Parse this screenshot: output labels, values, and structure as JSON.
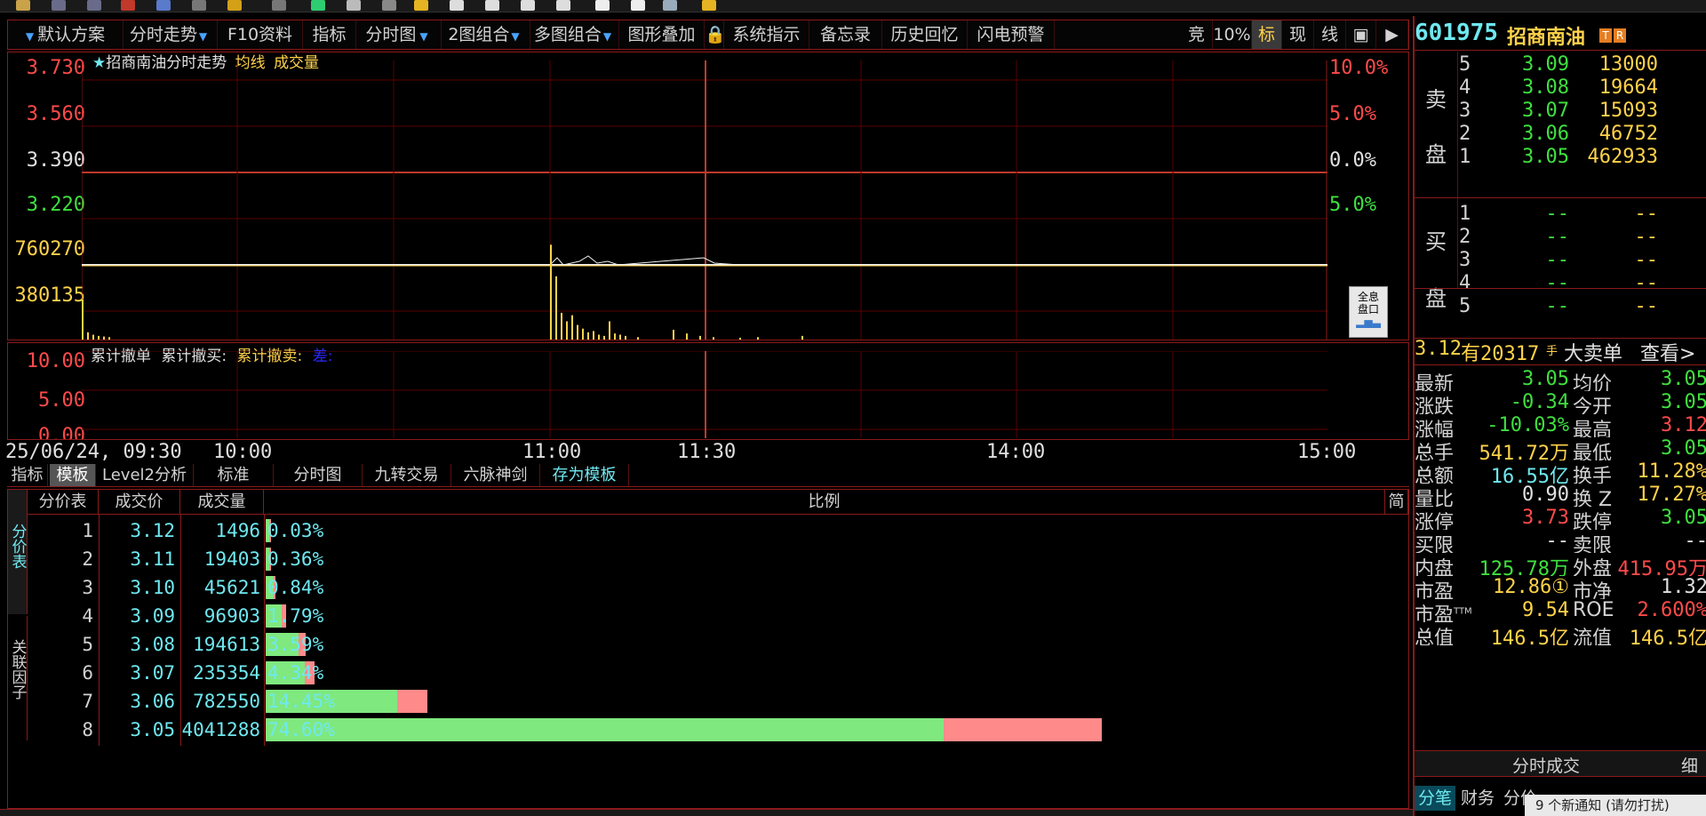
{
  "menu": {
    "items": [
      "默认方案",
      "分时走势",
      "F10资料",
      "指标",
      "分时图",
      "2图组合",
      "多图组合",
      "图形叠加",
      "系统指示",
      "备忘录",
      "历史回忆",
      "闪电预警"
    ],
    "right": [
      "竞",
      "10%",
      "标",
      "现",
      "线"
    ]
  },
  "stock": {
    "code": "601975",
    "name": "招商南油",
    "badges": [
      "T",
      "R"
    ]
  },
  "chart": {
    "title_star": "★",
    "title": "招商南油分时走势",
    "avg_line": "均线",
    "volume": "成交量"
  },
  "chart_data": [
    {
      "type": "line",
      "y_ticks": [
        3.73,
        3.56,
        3.39,
        3.22
      ],
      "y_tick_labels": [
        "3.730",
        "3.560",
        "3.390",
        "3.220"
      ],
      "pct_ticks": [
        "10.0%",
        "5.0%",
        "0.0%",
        "5.0%"
      ],
      "ylim": [
        3.05,
        3.73
      ],
      "x_tick_labels": [
        "25/06/24, 09:30",
        "10:00",
        "11:00",
        "11:30",
        "14:00",
        "15:00"
      ],
      "series": [
        {
          "name": "均线",
          "values": [
            3.05,
            3.05,
            3.05,
            3.05,
            3.05
          ]
        }
      ]
    },
    {
      "type": "bar",
      "y_tick_labels": [
        "760270",
        "380135"
      ],
      "ylim": [
        0,
        1140405
      ],
      "values": [
        330000,
        60000,
        40000,
        30000,
        25000,
        20000,
        780000,
        520000,
        220000,
        150000,
        200000,
        120000,
        90000,
        60000,
        70000,
        40000,
        30000,
        150000,
        50000,
        40000,
        30000,
        20000,
        80000,
        50000,
        30000,
        20000,
        15000,
        20000,
        30000
      ]
    },
    {
      "type": "line",
      "title": "累计撤单",
      "y_tick_labels": [
        "10.00",
        "5.00",
        "0.00"
      ],
      "legend": [
        "累计撤买:",
        "累计撤卖:",
        "差:"
      ]
    }
  ],
  "tabs": [
    "指标",
    "模板",
    "Level2分析",
    "标准",
    "分时图",
    "九转交易",
    "六脉神剑",
    "存为模板"
  ],
  "table": {
    "side_tabs": [
      "分价表",
      "关联因子"
    ],
    "headers": [
      "分价表",
      "成交价",
      "成交量",
      "比例",
      "简"
    ],
    "rows": [
      {
        "no": "1",
        "price": "3.12",
        "vol": "1496",
        "pct": "0.03%",
        "p": 0.03
      },
      {
        "no": "2",
        "price": "3.11",
        "vol": "19403",
        "pct": "0.36%",
        "p": 0.36
      },
      {
        "no": "3",
        "price": "3.10",
        "vol": "45621",
        "pct": "0.84%",
        "p": 0.84
      },
      {
        "no": "4",
        "price": "3.09",
        "vol": "96903",
        "pct": "1.79%",
        "p": 1.79
      },
      {
        "no": "5",
        "price": "3.08",
        "vol": "194613",
        "pct": "3.59%",
        "p": 3.59
      },
      {
        "no": "6",
        "price": "3.07",
        "vol": "235354",
        "pct": "4.34%",
        "p": 4.34
      },
      {
        "no": "7",
        "price": "3.06",
        "vol": "782550",
        "pct": "14.45%",
        "p": 14.45
      },
      {
        "no": "8",
        "price": "3.05",
        "vol": "4041288",
        "pct": "74.60%",
        "p": 74.6
      }
    ]
  },
  "orderbook": {
    "sell_label": [
      "卖",
      "盘"
    ],
    "buy_label": [
      "买",
      "盘"
    ],
    "sell": [
      {
        "lvl": "5",
        "price": "3.09",
        "vol": "13000"
      },
      {
        "lvl": "4",
        "price": "3.08",
        "vol": "19664"
      },
      {
        "lvl": "3",
        "price": "3.07",
        "vol": "15093"
      },
      {
        "lvl": "2",
        "price": "3.06",
        "vol": "46752"
      },
      {
        "lvl": "1",
        "price": "3.05",
        "vol": "462933"
      }
    ],
    "buy": [
      {
        "lvl": "1",
        "price": "--",
        "vol": "--"
      },
      {
        "lvl": "2",
        "price": "--",
        "vol": "--"
      },
      {
        "lvl": "3",
        "price": "--",
        "vol": "--"
      },
      {
        "lvl": "4",
        "price": "--",
        "vol": "--"
      },
      {
        "lvl": "5",
        "price": "--",
        "vol": "--"
      }
    ]
  },
  "bigsell": {
    "price": "3.12",
    "text": "有20317",
    "unit": "手",
    "label": "大卖单",
    "link": "查看>"
  },
  "quote": [
    {
      "l1": "最新",
      "v1": "3.05",
      "l2": "均价",
      "v2": "3.05"
    },
    {
      "l1": "涨跌",
      "v1": "-0.34",
      "l2": "今开",
      "v2": "3.05"
    },
    {
      "l1": "涨幅",
      "v1": "-10.03%",
      "l2": "最高",
      "v2": "3.12"
    },
    {
      "l1": "总手",
      "v1": "541.72万",
      "l2": "最低",
      "v2": "3.05"
    },
    {
      "l1": "总额",
      "v1": "16.55亿",
      "l2": "换手",
      "v2": "11.28%"
    },
    {
      "l1": "量比",
      "v1": "0.90",
      "l2": "换 Z",
      "v2": "17.27%"
    },
    {
      "l1": "涨停",
      "v1": "3.73",
      "l2": "跌停",
      "v2": "3.05"
    },
    {
      "l1": "买限",
      "v1": "--",
      "l2": "卖限",
      "v2": "--"
    },
    {
      "l1": "内盘",
      "v1": "125.78万",
      "l2": "外盘",
      "v2": "415.95万"
    },
    {
      "l1": "市盈",
      "v1": "12.86①",
      "l2": "市净",
      "v2": "1.32"
    },
    {
      "l1": "市盈TTM",
      "v1": "9.54",
      "l2": "ROE",
      "v2": "2.600%"
    },
    {
      "l1": "总值",
      "v1": "146.5亿",
      "l2": "流值",
      "v2": "146.5亿"
    }
  ],
  "trades": {
    "title": "分时成交",
    "detail": "细"
  },
  "bottom_tabs": [
    "分笔",
    "财务",
    "分价"
  ],
  "notice": "9 个新通知 (请勿打扰)",
  "fullinfo": {
    "l1": "全息",
    "l2": "盘口"
  },
  "colors": {
    "up": "#ff4a4a",
    "down": "#3fe03f",
    "cyan": "#6fe8f0",
    "yellow": "#ffd24a",
    "grid": "#5a0000",
    "frame": "#8a1a1a"
  }
}
